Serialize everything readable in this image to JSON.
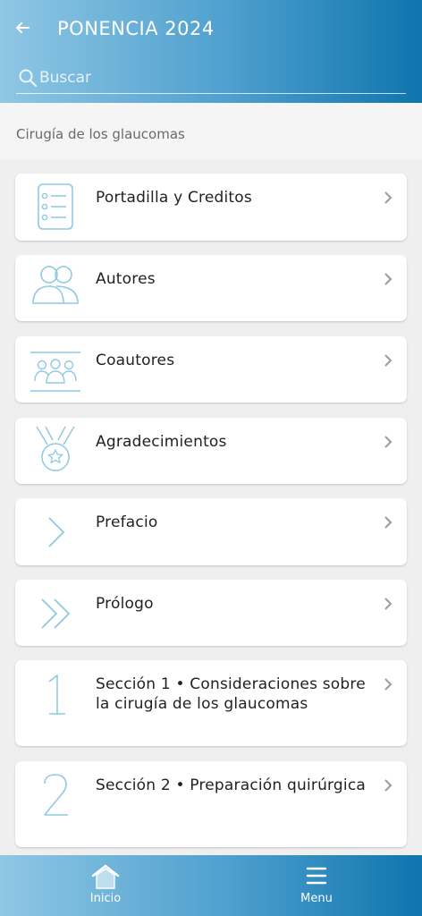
{
  "header": {
    "title": "PONENCIA 2024",
    "back_icon": "arrow-left-icon",
    "search": {
      "placeholder": "Buscar",
      "value": "",
      "icon": "search-icon"
    }
  },
  "section_label": "Cirugía de los glaucomas",
  "items": [
    {
      "label": "Portadilla y Creditos",
      "icon": "list-document-icon"
    },
    {
      "label": "Autores",
      "icon": "two-people-icon"
    },
    {
      "label": "Coautores",
      "icon": "group-icon"
    },
    {
      "label": "Agradecimientos",
      "icon": "medal-icon"
    },
    {
      "label": "Prefacio",
      "icon": "chevron-right-icon"
    },
    {
      "label": "Prólogo",
      "icon": "double-chevron-icon"
    },
    {
      "label": "Sección 1 • Consideraciones sobre la cirugía de los glaucomas",
      "icon": "number-1-icon"
    },
    {
      "label": "Sección 2 • Preparación quirúrgica",
      "icon": "number-2-icon"
    }
  ],
  "bottom_nav": [
    {
      "label": "Inicio",
      "icon": "home-icon"
    },
    {
      "label": "Menu",
      "icon": "hamburger-menu-icon"
    }
  ],
  "colors": {
    "accent": "#0f75ae",
    "accent_light": "#8fc7e4",
    "icon_stroke": "#8fc9e2"
  }
}
